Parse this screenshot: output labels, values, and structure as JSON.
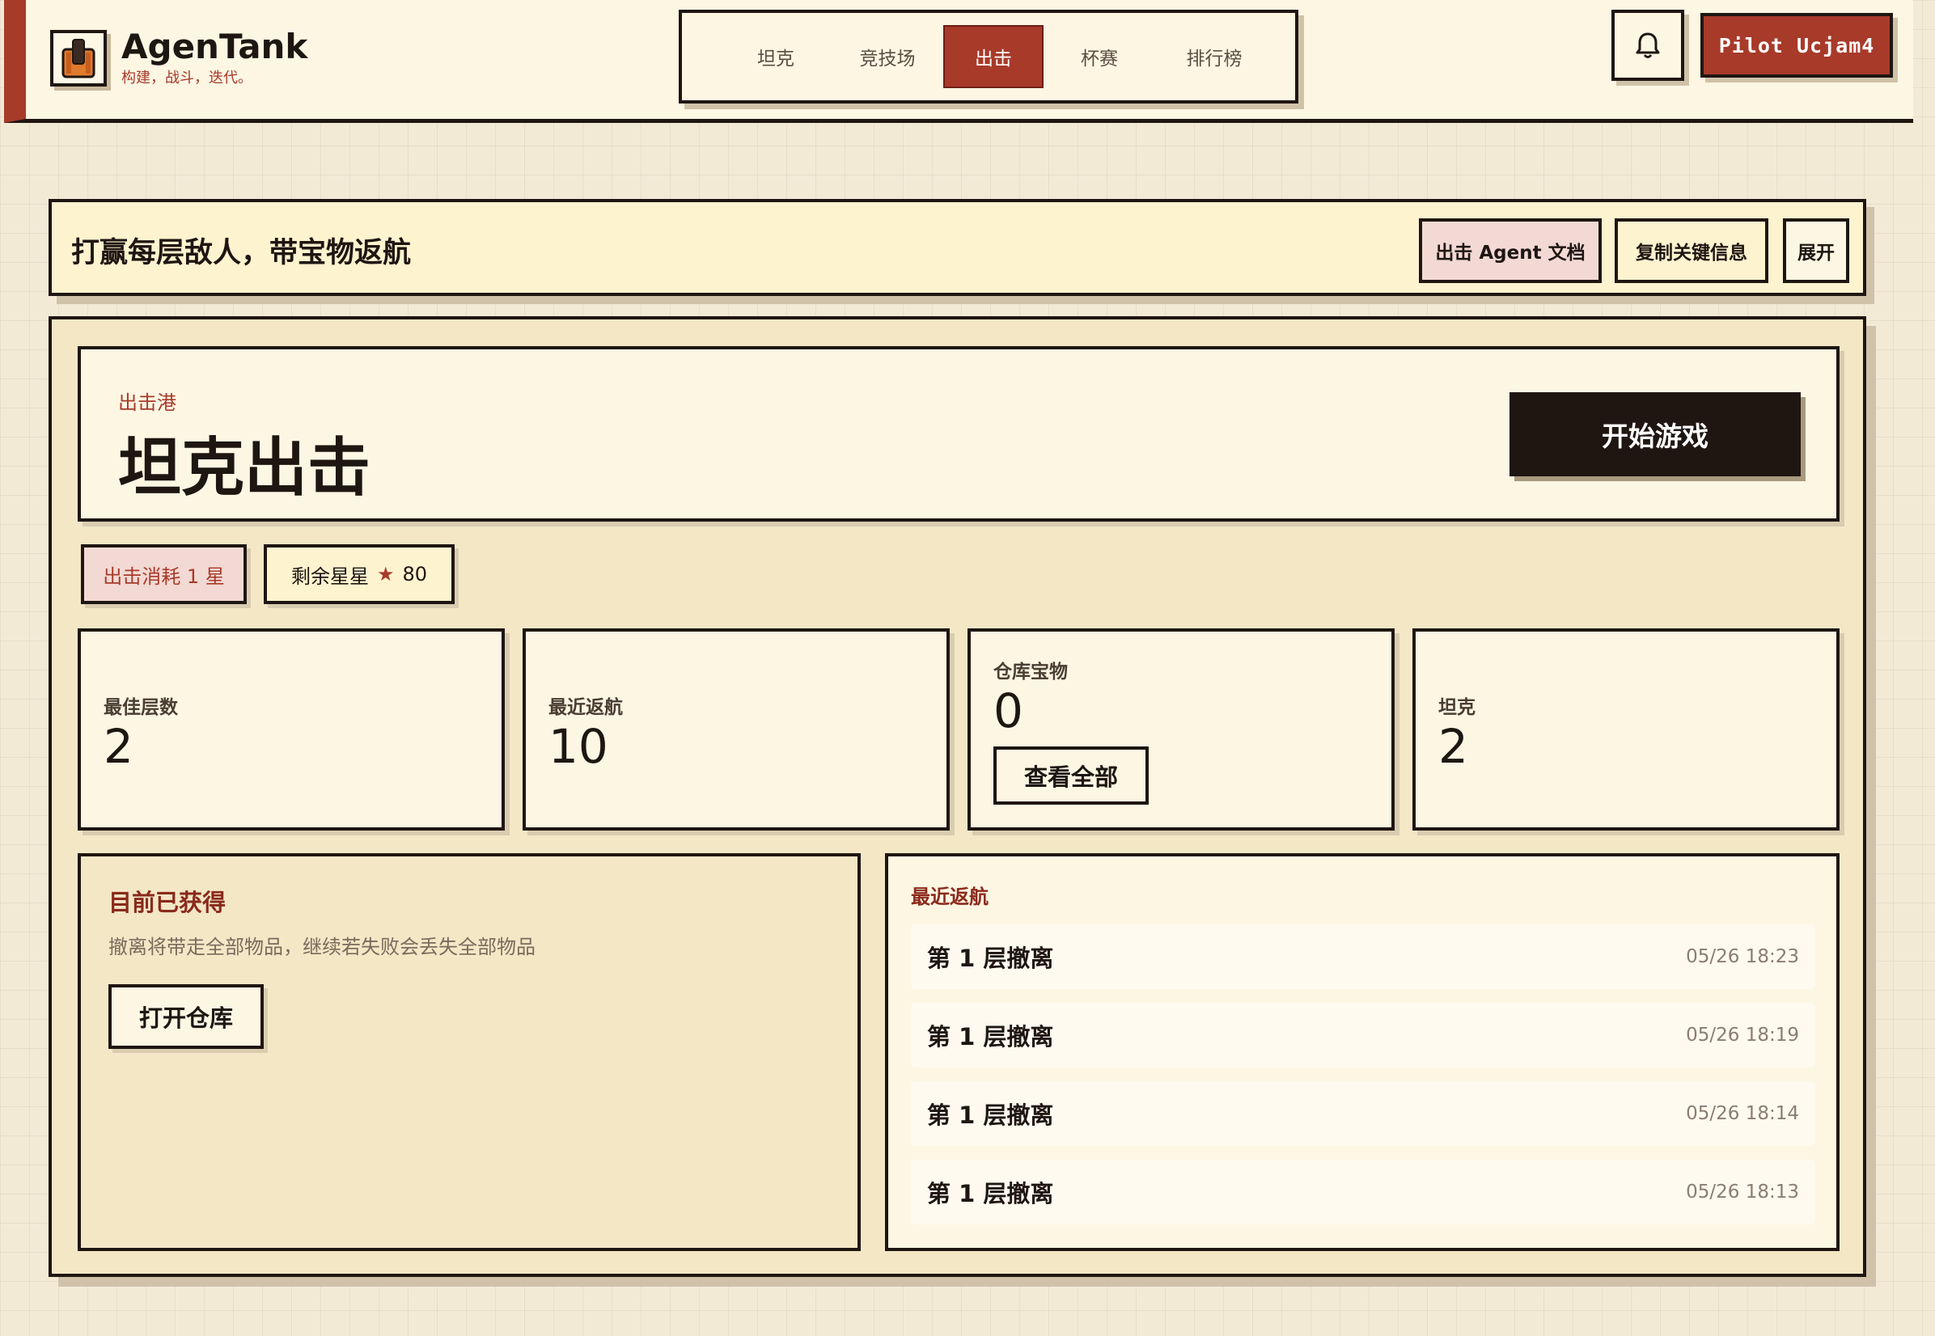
{
  "brand": {
    "name": "AgenTank",
    "tagline": "构建，战斗，迭代。"
  },
  "nav": {
    "items": [
      {
        "label": "坦克",
        "active": false
      },
      {
        "label": "竞技场",
        "active": false
      },
      {
        "label": "出击",
        "active": true
      },
      {
        "label": "杯赛",
        "active": false
      },
      {
        "label": "排行榜",
        "active": false
      }
    ]
  },
  "header": {
    "pilot_label": "Pilot Ucjam4",
    "notification_icon": "bell-icon"
  },
  "mission_bar": {
    "title": "打赢每层敌人，带宝物返航",
    "docs_button": "出击 Agent 文档",
    "copy_button": "复制关键信息",
    "expand_button": "展开"
  },
  "hero": {
    "eyebrow": "出击港",
    "title": "坦克出击",
    "start_button": "开始游戏"
  },
  "chips": {
    "cost": "出击消耗 1 星",
    "stars_label": "剩余星星",
    "stars_value": "80"
  },
  "stats": {
    "best_floor": {
      "label": "最佳层数",
      "value": "2"
    },
    "recent_return": {
      "label": "最近返航",
      "value": "10"
    },
    "vault": {
      "label": "仓库宝物",
      "value": "0",
      "button": "查看全部"
    },
    "tanks": {
      "label": "坦克",
      "value": "2"
    }
  },
  "gained": {
    "title": "目前已获得",
    "description": "撤离将带走全部物品，继续若失败会丢失全部物品",
    "button": "打开仓库"
  },
  "recent": {
    "title": "最近返航",
    "rows": [
      {
        "label": "第 1 层撤离",
        "time": "05/26 18:23"
      },
      {
        "label": "第 1 层撤离",
        "time": "05/26 18:19"
      },
      {
        "label": "第 1 层撤离",
        "time": "05/26 18:14"
      },
      {
        "label": "第 1 层撤离",
        "time": "05/26 18:13"
      }
    ]
  },
  "colors": {
    "accent": "#a83a2a",
    "ink": "#1f1612",
    "paper": "#fdf6e3",
    "panel": "#f3e7c6"
  }
}
